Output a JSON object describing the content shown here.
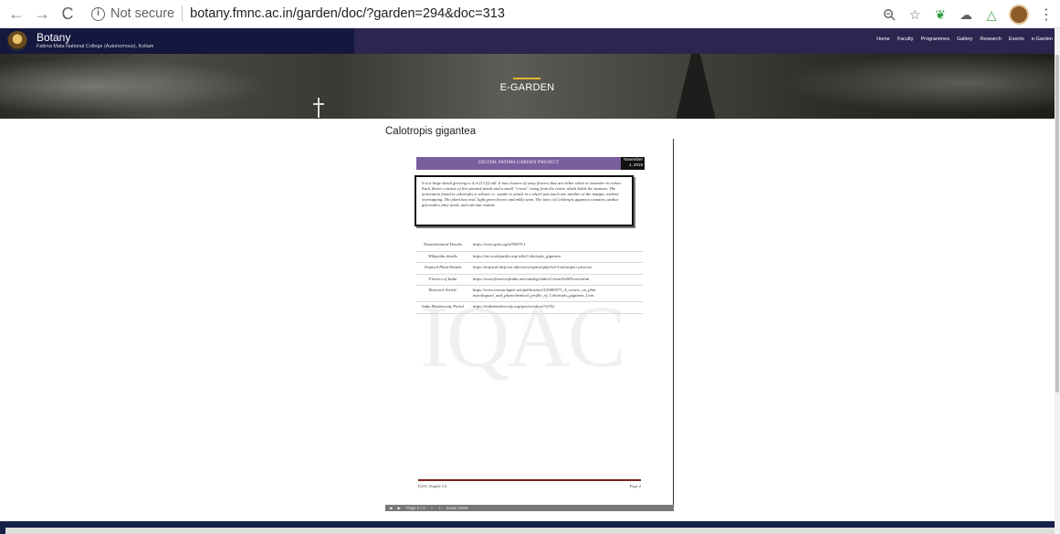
{
  "browser": {
    "back": "←",
    "forward": "→",
    "reload": "C",
    "security_label": "Not secure",
    "url": "botany.fmnc.ac.in/garden/doc/?garden=294&doc=313"
  },
  "site": {
    "brand_title": "Botany",
    "brand_subtitle": "Fatima Mata National College (Autonomous), Kollam",
    "nav": [
      "Home",
      "Faculty",
      "Programmes",
      "Gallery",
      "Research",
      "Events",
      "e-Garden"
    ],
    "hero_title": "E-GARDEN",
    "accent_color": "#e1b631",
    "header_color": "#2b2550"
  },
  "page": {
    "title": "Calotropis gigantea"
  },
  "pdf": {
    "header_title": "DIGITAL FATIMA GARDEN PROJECT",
    "date": "November 1, 2019",
    "description": "It is a large shrub growing to 4 m (13 ft) tall. It has clusters of waxy flowers that are either white or lavender in colour. Each flower consists of five pointed petals and a small \"crown\" rising from the centre which holds the stamens. The aestivation found in calotropis is valvate i.e. sepals or petals in a whorl just touch one another at the margin, without overlapping. The plant has oval, light green leaves and milky stem. The latex of Calotropis gigantea contains cardiac glycosides, fatty acids, and calcium oxalate.",
    "links": [
      {
        "label": "Nomenclatural Details",
        "value": "https://www.ipni.org/n/95075-1"
      },
      {
        "label": "Wikipedia details",
        "value": "https://en.m.wikipedia.org/wiki/Calotropis_gigantea"
      },
      {
        "label": "Tropical Plant Details",
        "value": "https://tropical.theferns.info/viewtropical.php?id=Calotropis+procera"
      },
      {
        "label": "Flowers of India",
        "value": "https://www.flowersofindia.net/catalog/slides/Crown%20Flower.html"
      },
      {
        "label": "Research Article",
        "value": "https://www.researchgate.net/publication/321680571_A_review_on_phar macological_and_phytochemical_profile_of_Calotropis_gigantea_Linn"
      },
      {
        "label": "India Biodiversity Portal",
        "value": "https://indiabiodiversity.org/species/show/32352"
      }
    ],
    "watermark": "IQAC",
    "footer_left": "IQAC Digital 2.0",
    "footer_right": "Page 2"
  },
  "pdf_toolbar": {
    "page_label": "Page 2 / 2",
    "zoom_label": "Zoom 100%"
  }
}
